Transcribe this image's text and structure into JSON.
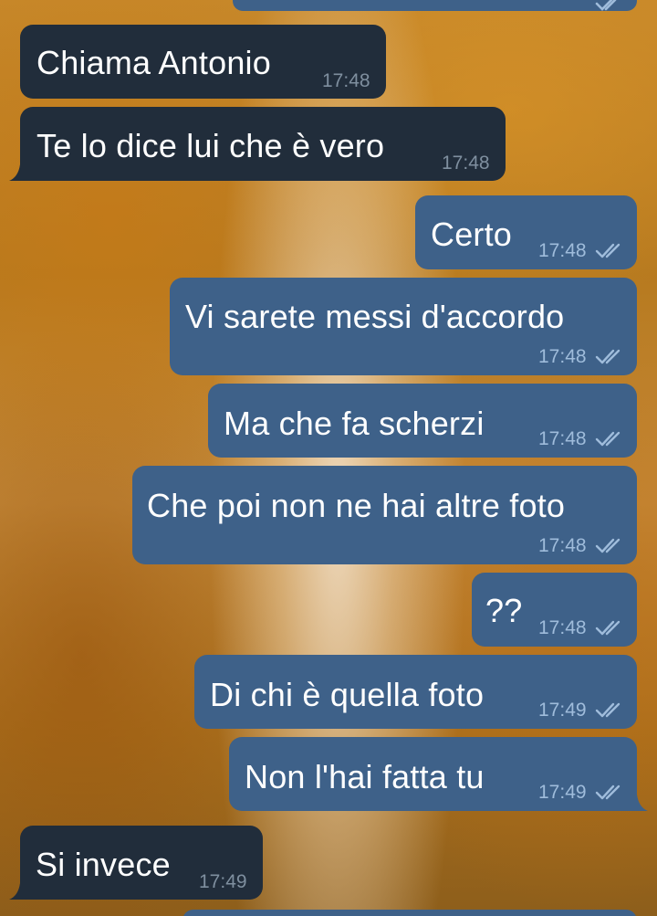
{
  "chat": {
    "messages": [
      {
        "text": "Chiama Antonio",
        "time": "17:48",
        "direction": "incoming"
      },
      {
        "text": "Te lo dice lui che è vero",
        "time": "17:48",
        "direction": "incoming"
      },
      {
        "text": "Certo",
        "time": "17:48",
        "direction": "outgoing",
        "status": "read-double-check-icon"
      },
      {
        "text": "Vi sarete messi d'accordo",
        "time": "17:48",
        "direction": "outgoing",
        "status": "read-double-check-icon"
      },
      {
        "text": "Ma che fa scherzi",
        "time": "17:48",
        "direction": "outgoing",
        "status": "read-double-check-icon"
      },
      {
        "text": "Che poi non ne hai altre foto",
        "time": "17:48",
        "direction": "outgoing",
        "status": "read-double-check-icon"
      },
      {
        "text": "??",
        "time": "17:48",
        "direction": "outgoing",
        "status": "read-double-check-icon"
      },
      {
        "text": "Di chi è quella foto",
        "time": "17:49",
        "direction": "outgoing",
        "status": "read-double-check-icon"
      },
      {
        "text": "Non l'hai fatta tu",
        "time": "17:49",
        "direction": "outgoing",
        "status": "read-double-check-icon"
      },
      {
        "text": "Si invece",
        "time": "17:49",
        "direction": "incoming"
      }
    ]
  },
  "colors": {
    "incoming_bubble": "#212d3b",
    "outgoing_bubble": "#3e6189",
    "incoming_time": "#7f8f9f",
    "outgoing_time": "#9fbcdb",
    "read_check": "#9fbcdb"
  }
}
